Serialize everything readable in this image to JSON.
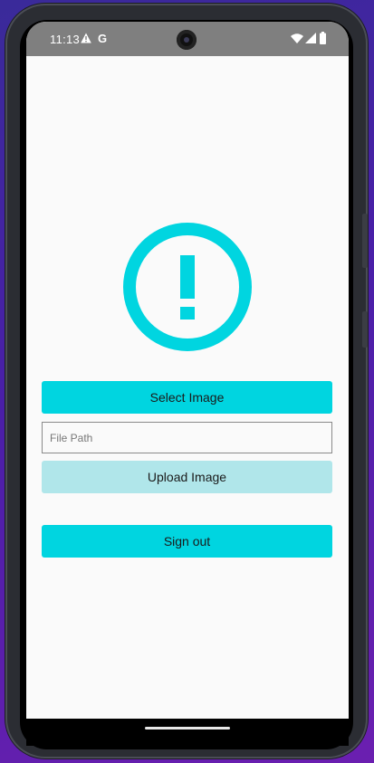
{
  "status_bar": {
    "time": "11:13",
    "google_glyph": "G",
    "icons": [
      "warning-icon",
      "wifi-icon",
      "cell-signal-icon",
      "battery-icon"
    ]
  },
  "main": {
    "alert_icon": "alert-circle-icon",
    "select_button_label": "Select Image",
    "file_path": {
      "value": "",
      "placeholder": "File Path"
    },
    "upload_button_label": "Upload Image",
    "sign_out_button_label": "Sign out"
  },
  "colors": {
    "accent": "#00d5e0",
    "accent_disabled": "#b0e6ea",
    "status_bar": "#7f7f7f",
    "screen_background": "#fafafa"
  }
}
